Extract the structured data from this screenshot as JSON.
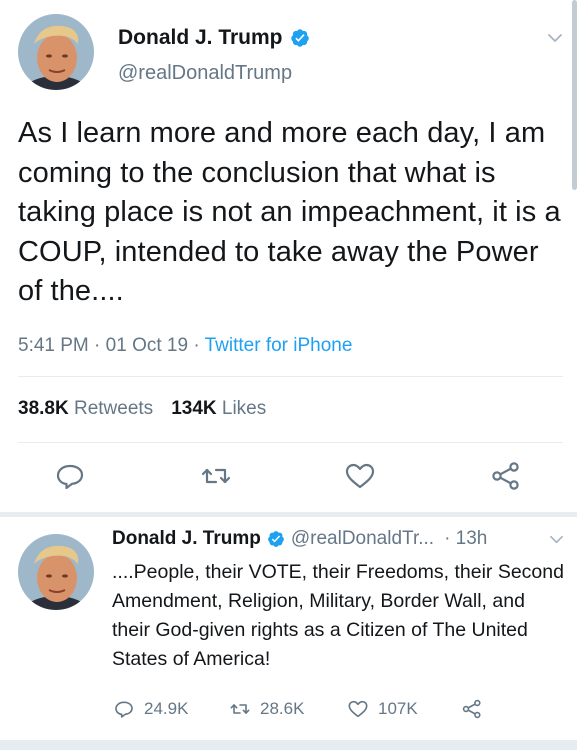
{
  "main_tweet": {
    "author_name": "Donald J. Trump",
    "handle": "@realDonaldTrump",
    "text": "As I learn more and more each day, I am coming to the conclusion that what is taking place is not an impeachment, it is a COUP, intended to take away the Power of the....",
    "time": "5:41 PM",
    "date": "01 Oct 19",
    "source": "Twitter for iPhone",
    "sep": "·",
    "retweets_count": "38.8K",
    "retweets_label": "Retweets",
    "likes_count": "134K",
    "likes_label": "Likes"
  },
  "reply_tweet": {
    "author_name": "Donald J. Trump",
    "handle": "@realDonaldTr...",
    "age": "· 13h",
    "text": "....People, their VOTE, their Freedoms, their Second Amendment, Religion, Military, Border Wall, and their God-given rights as a Citizen of The United States of America!",
    "replies": "24.9K",
    "retweets": "28.6K",
    "likes": "107K"
  },
  "icons": {
    "verified": "verified-badge-icon",
    "chevron": "chevron-down-icon",
    "reply": "reply-icon",
    "retweet": "retweet-icon",
    "like": "heart-icon",
    "share": "share-icon"
  },
  "colors": {
    "accent": "#1da1f2",
    "text": "#14171a",
    "secondary": "#657786",
    "divider": "#e6ecf0"
  }
}
